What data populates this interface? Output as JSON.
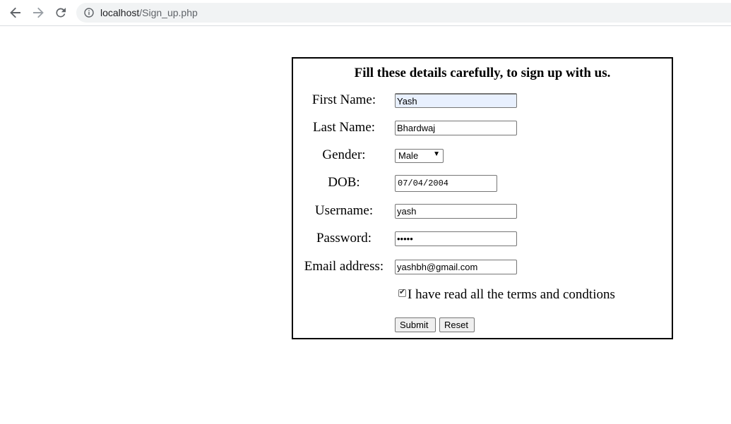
{
  "browser": {
    "url_host": "localhost",
    "url_path": "/Sign_up.php",
    "icons": {
      "back": "back-arrow-icon",
      "forward": "forward-arrow-icon",
      "reload": "reload-icon",
      "info": "info-icon"
    }
  },
  "form": {
    "title": "Fill these details carefully, to sign up with us.",
    "fields": {
      "first_name": {
        "label": "First Name:",
        "value": "Yash"
      },
      "last_name": {
        "label": "Last Name:",
        "value": "Bhardwaj"
      },
      "gender": {
        "label": "Gender:",
        "value": "Male"
      },
      "dob": {
        "label": "DOB:",
        "value": "07/04/2004"
      },
      "username": {
        "label": "Username:",
        "value": "yash"
      },
      "password": {
        "label": "Password:",
        "value": "•••••"
      },
      "email": {
        "label": "Email address:",
        "value": "yashbh@gmail.com"
      }
    },
    "terms": {
      "label": "I have read all the terms and condtions",
      "checked": true
    },
    "buttons": {
      "submit": "Submit",
      "reset": "Reset"
    }
  }
}
